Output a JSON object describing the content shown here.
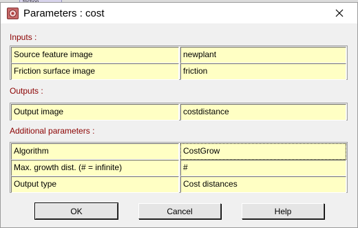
{
  "window": {
    "title": "Parameters : cost",
    "icon": "app-icon"
  },
  "background": {
    "tab_label": "friction"
  },
  "sections": {
    "inputs": {
      "label": "Inputs :",
      "rows": [
        {
          "label": "Source feature image",
          "value": "newplant"
        },
        {
          "label": "Friction surface image",
          "value": "friction"
        }
      ]
    },
    "outputs": {
      "label": "Outputs :",
      "rows": [
        {
          "label": "Output image",
          "value": "costdistance"
        }
      ]
    },
    "additional": {
      "label": "Additional parameters :",
      "rows": [
        {
          "label": "Algorithm",
          "value": "CostGrow"
        },
        {
          "label": "Max. growth dist. (# = infinite)",
          "value": "#"
        },
        {
          "label": "Output type",
          "value": "Cost distances"
        }
      ]
    }
  },
  "buttons": {
    "ok": "OK",
    "cancel": "Cancel",
    "help": "Help"
  },
  "colors": {
    "section_label": "#8b0000",
    "cell_background": "#ffffc4"
  }
}
